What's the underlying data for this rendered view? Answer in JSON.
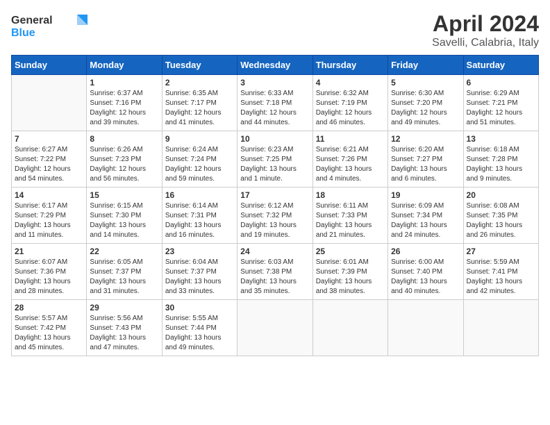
{
  "logo": {
    "text_general": "General",
    "text_blue": "Blue"
  },
  "title": "April 2024",
  "subtitle": "Savelli, Calabria, Italy",
  "weekdays": [
    "Sunday",
    "Monday",
    "Tuesday",
    "Wednesday",
    "Thursday",
    "Friday",
    "Saturday"
  ],
  "weeks": [
    [
      {
        "day": "",
        "sunrise": "",
        "sunset": "",
        "daylight": ""
      },
      {
        "day": "1",
        "sunrise": "Sunrise: 6:37 AM",
        "sunset": "Sunset: 7:16 PM",
        "daylight": "Daylight: 12 hours and 39 minutes."
      },
      {
        "day": "2",
        "sunrise": "Sunrise: 6:35 AM",
        "sunset": "Sunset: 7:17 PM",
        "daylight": "Daylight: 12 hours and 41 minutes."
      },
      {
        "day": "3",
        "sunrise": "Sunrise: 6:33 AM",
        "sunset": "Sunset: 7:18 PM",
        "daylight": "Daylight: 12 hours and 44 minutes."
      },
      {
        "day": "4",
        "sunrise": "Sunrise: 6:32 AM",
        "sunset": "Sunset: 7:19 PM",
        "daylight": "Daylight: 12 hours and 46 minutes."
      },
      {
        "day": "5",
        "sunrise": "Sunrise: 6:30 AM",
        "sunset": "Sunset: 7:20 PM",
        "daylight": "Daylight: 12 hours and 49 minutes."
      },
      {
        "day": "6",
        "sunrise": "Sunrise: 6:29 AM",
        "sunset": "Sunset: 7:21 PM",
        "daylight": "Daylight: 12 hours and 51 minutes."
      }
    ],
    [
      {
        "day": "7",
        "sunrise": "Sunrise: 6:27 AM",
        "sunset": "Sunset: 7:22 PM",
        "daylight": "Daylight: 12 hours and 54 minutes."
      },
      {
        "day": "8",
        "sunrise": "Sunrise: 6:26 AM",
        "sunset": "Sunset: 7:23 PM",
        "daylight": "Daylight: 12 hours and 56 minutes."
      },
      {
        "day": "9",
        "sunrise": "Sunrise: 6:24 AM",
        "sunset": "Sunset: 7:24 PM",
        "daylight": "Daylight: 12 hours and 59 minutes."
      },
      {
        "day": "10",
        "sunrise": "Sunrise: 6:23 AM",
        "sunset": "Sunset: 7:25 PM",
        "daylight": "Daylight: 13 hours and 1 minute."
      },
      {
        "day": "11",
        "sunrise": "Sunrise: 6:21 AM",
        "sunset": "Sunset: 7:26 PM",
        "daylight": "Daylight: 13 hours and 4 minutes."
      },
      {
        "day": "12",
        "sunrise": "Sunrise: 6:20 AM",
        "sunset": "Sunset: 7:27 PM",
        "daylight": "Daylight: 13 hours and 6 minutes."
      },
      {
        "day": "13",
        "sunrise": "Sunrise: 6:18 AM",
        "sunset": "Sunset: 7:28 PM",
        "daylight": "Daylight: 13 hours and 9 minutes."
      }
    ],
    [
      {
        "day": "14",
        "sunrise": "Sunrise: 6:17 AM",
        "sunset": "Sunset: 7:29 PM",
        "daylight": "Daylight: 13 hours and 11 minutes."
      },
      {
        "day": "15",
        "sunrise": "Sunrise: 6:15 AM",
        "sunset": "Sunset: 7:30 PM",
        "daylight": "Daylight: 13 hours and 14 minutes."
      },
      {
        "day": "16",
        "sunrise": "Sunrise: 6:14 AM",
        "sunset": "Sunset: 7:31 PM",
        "daylight": "Daylight: 13 hours and 16 minutes."
      },
      {
        "day": "17",
        "sunrise": "Sunrise: 6:12 AM",
        "sunset": "Sunset: 7:32 PM",
        "daylight": "Daylight: 13 hours and 19 minutes."
      },
      {
        "day": "18",
        "sunrise": "Sunrise: 6:11 AM",
        "sunset": "Sunset: 7:33 PM",
        "daylight": "Daylight: 13 hours and 21 minutes."
      },
      {
        "day": "19",
        "sunrise": "Sunrise: 6:09 AM",
        "sunset": "Sunset: 7:34 PM",
        "daylight": "Daylight: 13 hours and 24 minutes."
      },
      {
        "day": "20",
        "sunrise": "Sunrise: 6:08 AM",
        "sunset": "Sunset: 7:35 PM",
        "daylight": "Daylight: 13 hours and 26 minutes."
      }
    ],
    [
      {
        "day": "21",
        "sunrise": "Sunrise: 6:07 AM",
        "sunset": "Sunset: 7:36 PM",
        "daylight": "Daylight: 13 hours and 28 minutes."
      },
      {
        "day": "22",
        "sunrise": "Sunrise: 6:05 AM",
        "sunset": "Sunset: 7:37 PM",
        "daylight": "Daylight: 13 hours and 31 minutes."
      },
      {
        "day": "23",
        "sunrise": "Sunrise: 6:04 AM",
        "sunset": "Sunset: 7:37 PM",
        "daylight": "Daylight: 13 hours and 33 minutes."
      },
      {
        "day": "24",
        "sunrise": "Sunrise: 6:03 AM",
        "sunset": "Sunset: 7:38 PM",
        "daylight": "Daylight: 13 hours and 35 minutes."
      },
      {
        "day": "25",
        "sunrise": "Sunrise: 6:01 AM",
        "sunset": "Sunset: 7:39 PM",
        "daylight": "Daylight: 13 hours and 38 minutes."
      },
      {
        "day": "26",
        "sunrise": "Sunrise: 6:00 AM",
        "sunset": "Sunset: 7:40 PM",
        "daylight": "Daylight: 13 hours and 40 minutes."
      },
      {
        "day": "27",
        "sunrise": "Sunrise: 5:59 AM",
        "sunset": "Sunset: 7:41 PM",
        "daylight": "Daylight: 13 hours and 42 minutes."
      }
    ],
    [
      {
        "day": "28",
        "sunrise": "Sunrise: 5:57 AM",
        "sunset": "Sunset: 7:42 PM",
        "daylight": "Daylight: 13 hours and 45 minutes."
      },
      {
        "day": "29",
        "sunrise": "Sunrise: 5:56 AM",
        "sunset": "Sunset: 7:43 PM",
        "daylight": "Daylight: 13 hours and 47 minutes."
      },
      {
        "day": "30",
        "sunrise": "Sunrise: 5:55 AM",
        "sunset": "Sunset: 7:44 PM",
        "daylight": "Daylight: 13 hours and 49 minutes."
      },
      {
        "day": "",
        "sunrise": "",
        "sunset": "",
        "daylight": ""
      },
      {
        "day": "",
        "sunrise": "",
        "sunset": "",
        "daylight": ""
      },
      {
        "day": "",
        "sunrise": "",
        "sunset": "",
        "daylight": ""
      },
      {
        "day": "",
        "sunrise": "",
        "sunset": "",
        "daylight": ""
      }
    ]
  ]
}
